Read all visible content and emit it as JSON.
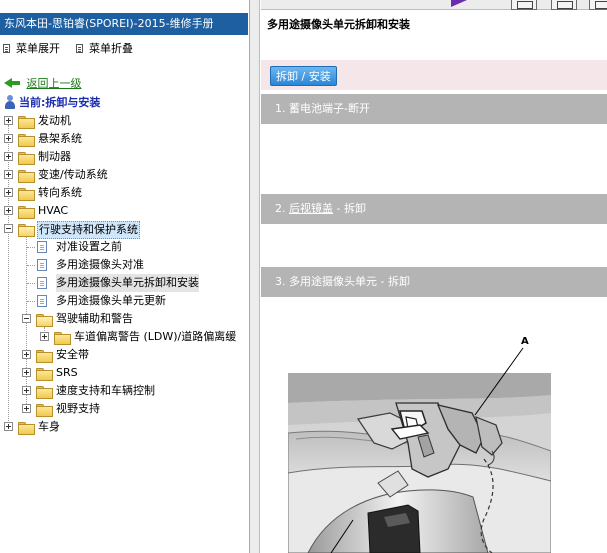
{
  "sidebar": {
    "title": "东风本田-思铂睿(SPOREI)-2015-维修手册",
    "expand_all": "菜单展开",
    "collapse_all": "菜单折叠",
    "back": "返回上一级",
    "current": "当前:拆卸与安装",
    "tree": [
      {
        "label": "发动机"
      },
      {
        "label": "悬架系统"
      },
      {
        "label": "制动器"
      },
      {
        "label": "变速/传动系统"
      },
      {
        "label": "转向系统"
      },
      {
        "label": "HVAC"
      },
      {
        "label": "行驶支持和保护系统"
      },
      {
        "label": "对准设置之前"
      },
      {
        "label": "多用途摄像头对准"
      },
      {
        "label": "多用途摄像头单元拆卸和安装"
      },
      {
        "label": "多用途摄像头单元更新"
      },
      {
        "label": "驾驶辅助和警告"
      },
      {
        "label": "车道偏离警告 (LDW)/道路偏离缓"
      },
      {
        "label": "安全带"
      },
      {
        "label": "SRS"
      },
      {
        "label": "速度支持和车辆控制"
      },
      {
        "label": "视野支持"
      },
      {
        "label": "车身"
      }
    ]
  },
  "content": {
    "title": "多用途摄像头单元拆卸和安装",
    "removal_button": "拆卸 / 安装",
    "steps": [
      {
        "num": "1.",
        "text": "蓄电池端子-断开"
      },
      {
        "num": "2.",
        "link": "后视镜盖",
        "text": " - 拆卸"
      },
      {
        "num": "3.",
        "text": "多用途摄像头单元 - 拆卸"
      }
    ],
    "figure_callout": "A"
  },
  "colors": {
    "sidebar_title_bg": "#1d5fa1",
    "step_band_bg": "#b4b4b4",
    "removal_band_bg": "#f5e6e9",
    "removal_button_bg": "#2a86d6",
    "back_link": "#1a7a1a",
    "current_label": "#1a2db0"
  }
}
